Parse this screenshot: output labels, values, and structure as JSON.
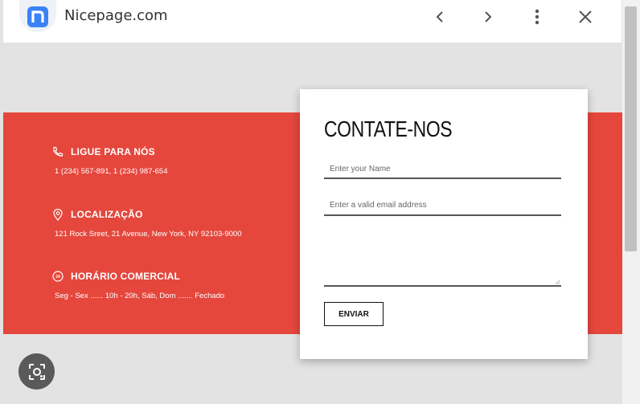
{
  "browser": {
    "title": "Nicepage.com",
    "icons": [
      "nicepage-logo-icon",
      "back-icon",
      "forward-icon",
      "more-icon",
      "close-icon"
    ]
  },
  "contact_info": {
    "phone": {
      "icon": "phone-icon",
      "title": "LIGUE PARA NÓS",
      "text": "1 (234) 567-891, 1 (234) 987-654"
    },
    "location": {
      "icon": "location-pin-icon",
      "title": "LOCALIZAÇÃO",
      "text": "121 Rock Sreet, 21 Avenue, New York, NY 92103-9000"
    },
    "hours": {
      "icon": "clock-24-icon",
      "title": "HORÁRIO COMERCIAL",
      "text": "Seg - Sex ...... 10h - 20h, Sáb, Dom ....... Fechado"
    }
  },
  "form": {
    "title": "CONTATE-NOS",
    "name_placeholder": "Enter your Name",
    "email_placeholder": "Enter a valid email address",
    "message_placeholder": "",
    "submit_label": "ENVIAR"
  },
  "colors": {
    "accent": "#e5473d",
    "card_bg": "#ffffff",
    "page_bg": "#e3e3e3",
    "logo": "#3b82f6"
  },
  "lens_icon": "lens-search-icon"
}
